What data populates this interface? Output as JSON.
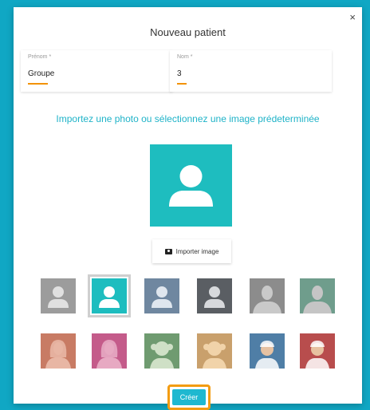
{
  "modal": {
    "title": "Nouveau patient",
    "close_label": "×"
  },
  "form": {
    "prenom": {
      "label": "Prénom *",
      "value": "Groupe"
    },
    "nom": {
      "label": "Nom *",
      "value": "3"
    }
  },
  "photo": {
    "heading": "Importez une photo ou sélectionnez une image prédeterminée",
    "import_label": "Importer image",
    "selected_color": "#1ebdbf"
  },
  "avatars": [
    {
      "icon": "generic-person-icon",
      "bg": "#9c9c9c",
      "fg": "#e0e0e0",
      "style": "generic"
    },
    {
      "icon": "generic-person-icon",
      "bg": "#1ebdbf",
      "fg": "#ffffff",
      "style": "generic",
      "selected": true
    },
    {
      "icon": "generic-person-icon",
      "bg": "#6f87a0",
      "fg": "#dfe6ee",
      "style": "generic"
    },
    {
      "icon": "generic-person-icon",
      "bg": "#5a5e63",
      "fg": "#d7d9dc",
      "style": "generic"
    },
    {
      "icon": "man-avatar-icon",
      "bg": "#8c8c8c",
      "fg": "#c9c9c9",
      "style": "man"
    },
    {
      "icon": "man-avatar-icon",
      "bg": "#6f9d8c",
      "fg": "#c5c5c5",
      "style": "man"
    },
    {
      "icon": "woman-avatar-icon",
      "bg": "#c87b64",
      "fg": "#e8b6a4",
      "style": "woman"
    },
    {
      "icon": "woman-avatar-icon",
      "bg": "#c45b8a",
      "fg": "#e7a9c2",
      "style": "woman"
    },
    {
      "icon": "girl-avatar-icon",
      "bg": "#6f9b70",
      "fg": "#cfe0c6",
      "style": "girl"
    },
    {
      "icon": "girl-avatar-icon",
      "bg": "#c9a06c",
      "fg": "#f1d3a9",
      "style": "girl"
    },
    {
      "icon": "boy-avatar-icon",
      "bg": "#4f7ea6",
      "fg": "#e6c2a2",
      "style": "boy"
    },
    {
      "icon": "boy-avatar-icon",
      "bg": "#b84d4d",
      "fg": "#e7c1a0",
      "style": "boy"
    }
  ],
  "actions": {
    "create_label": "Créer"
  }
}
